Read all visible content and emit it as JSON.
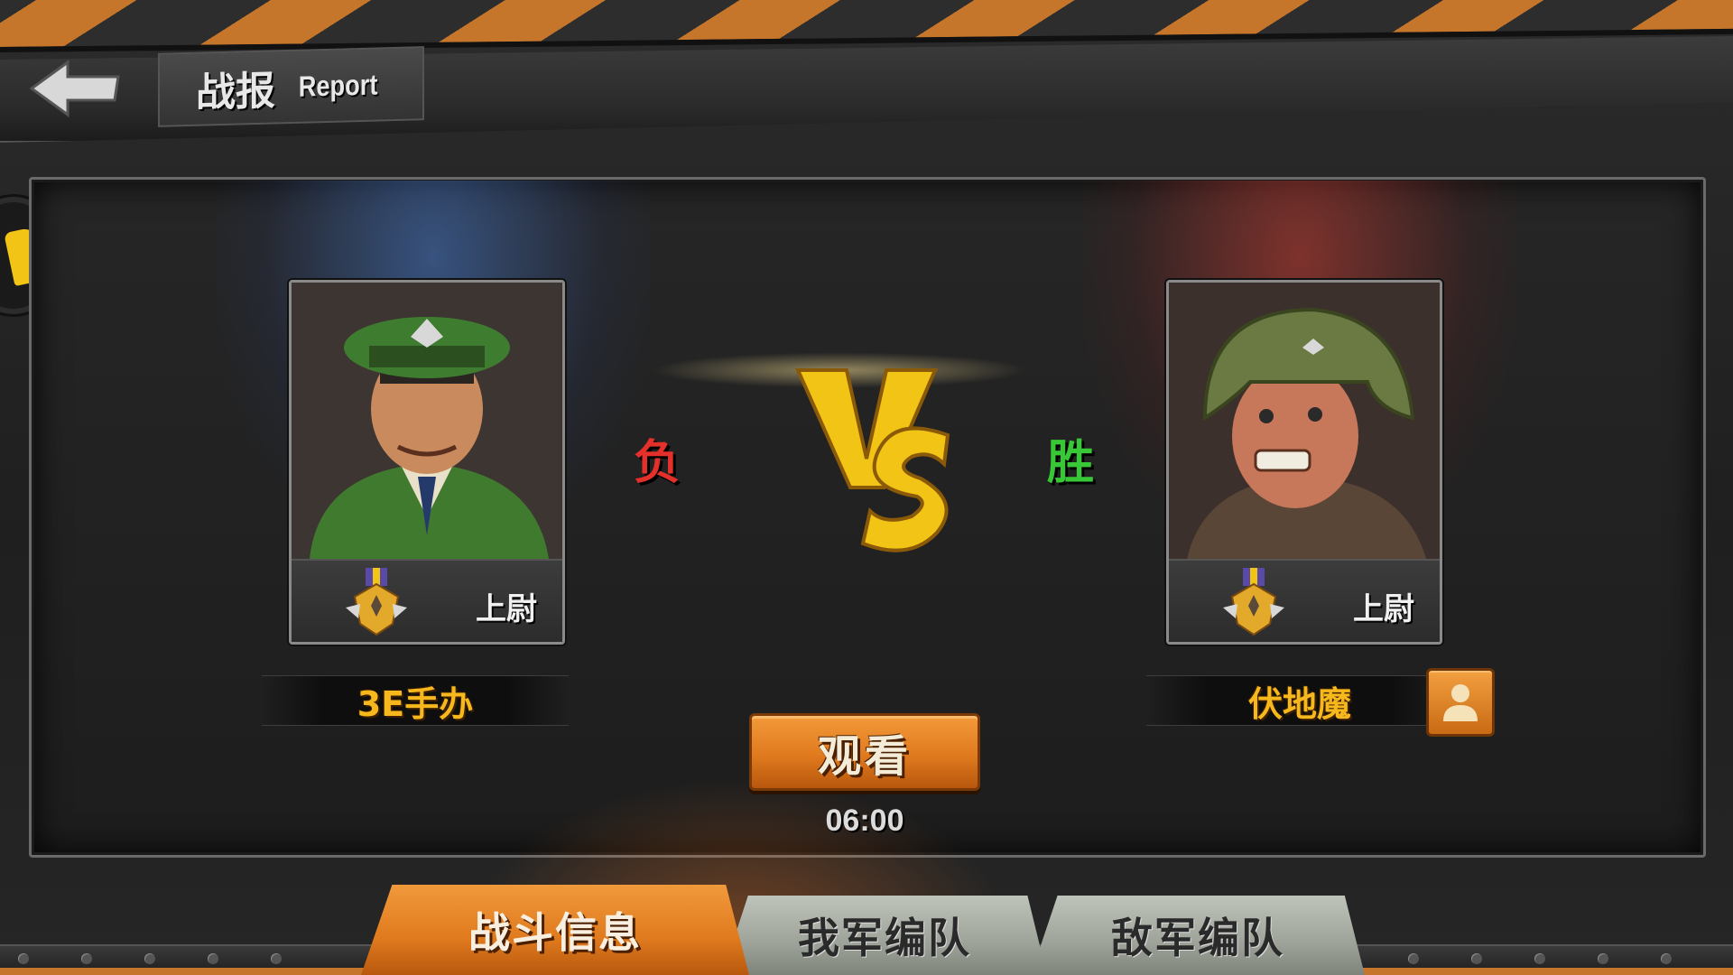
{
  "header": {
    "title_cn": "战报",
    "title_en": "Report",
    "back_icon": "back-arrow-icon"
  },
  "battle": {
    "left": {
      "name": "3E手办",
      "rank": "上尉",
      "result": "负",
      "result_color": "#e3302a",
      "glow_color": "#4678c8"
    },
    "right": {
      "name": "伏地魔",
      "rank": "上尉",
      "result": "胜",
      "result_color": "#38c837",
      "glow_color": "#c83c32"
    },
    "vs_text": "VS"
  },
  "actions": {
    "watch_label": "观看",
    "duration": "06:00",
    "profile_icon": "person-icon"
  },
  "tabs": [
    {
      "label": "战斗信息",
      "active": true
    },
    {
      "label": "我军编队",
      "active": false
    },
    {
      "label": "敌军编队",
      "active": false
    }
  ],
  "colors": {
    "accent_orange": "#e07a1e",
    "name_gold": "#f6b81d",
    "vs_gold": "#f2c415"
  }
}
